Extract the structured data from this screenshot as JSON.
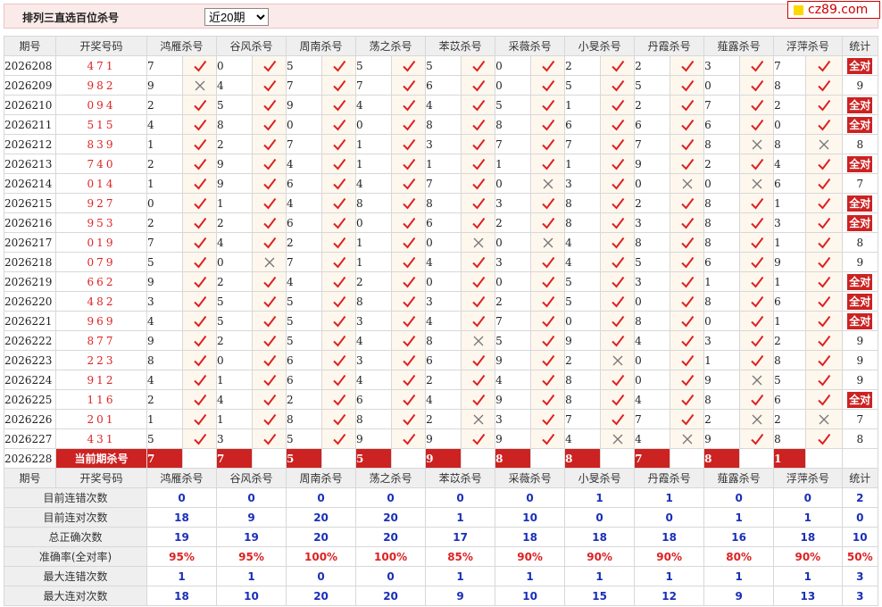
{
  "title": "排列三直选百位杀号",
  "period_select": {
    "value": "近20期",
    "options": [
      "近20期"
    ]
  },
  "logo": "cz89.com",
  "colors": {
    "hit": "#d22",
    "miss": "#777",
    "accent": "#cc2222",
    "stat": "#1a2fb8"
  },
  "headers": [
    "期号",
    "开奖号码",
    "鸿雁杀号",
    "谷风杀号",
    "周南杀号",
    "荡之杀号",
    "苯苡杀号",
    "采薇杀号",
    "小旻杀号",
    "丹霞杀号",
    "薤露杀号",
    "浮萍杀号",
    "统计"
  ],
  "rows": [
    {
      "period": "2026208",
      "drawn": "471",
      "kills": [
        "7",
        "0",
        "5",
        "5",
        "5",
        "0",
        "2",
        "2",
        "3",
        "7"
      ],
      "hits": [
        1,
        1,
        1,
        1,
        1,
        1,
        1,
        1,
        1,
        1
      ],
      "total": "全对"
    },
    {
      "period": "2026209",
      "drawn": "982",
      "kills": [
        "9",
        "4",
        "7",
        "7",
        "6",
        "0",
        "5",
        "5",
        "0",
        "8"
      ],
      "hits": [
        0,
        1,
        1,
        1,
        1,
        1,
        1,
        1,
        1,
        1
      ],
      "total": "9"
    },
    {
      "period": "2026210",
      "drawn": "094",
      "kills": [
        "2",
        "5",
        "9",
        "4",
        "4",
        "5",
        "1",
        "2",
        "7",
        "2"
      ],
      "hits": [
        1,
        1,
        1,
        1,
        1,
        1,
        1,
        1,
        1,
        1
      ],
      "total": "全对"
    },
    {
      "period": "2026211",
      "drawn": "515",
      "kills": [
        "4",
        "8",
        "0",
        "0",
        "8",
        "8",
        "6",
        "6",
        "6",
        "0"
      ],
      "hits": [
        1,
        1,
        1,
        1,
        1,
        1,
        1,
        1,
        1,
        1
      ],
      "total": "全对"
    },
    {
      "period": "2026212",
      "drawn": "839",
      "kills": [
        "1",
        "2",
        "7",
        "1",
        "3",
        "7",
        "7",
        "7",
        "8",
        "8"
      ],
      "hits": [
        1,
        1,
        1,
        1,
        1,
        1,
        1,
        1,
        0,
        0
      ],
      "total": "8"
    },
    {
      "period": "2026213",
      "drawn": "740",
      "kills": [
        "2",
        "9",
        "4",
        "1",
        "1",
        "1",
        "1",
        "9",
        "2",
        "4"
      ],
      "hits": [
        1,
        1,
        1,
        1,
        1,
        1,
        1,
        1,
        1,
        1
      ],
      "total": "全对"
    },
    {
      "period": "2026214",
      "drawn": "014",
      "kills": [
        "1",
        "9",
        "6",
        "4",
        "7",
        "0",
        "3",
        "0",
        "0",
        "6"
      ],
      "hits": [
        1,
        1,
        1,
        1,
        1,
        0,
        1,
        0,
        0,
        1
      ],
      "total": "7"
    },
    {
      "period": "2026215",
      "drawn": "927",
      "kills": [
        "0",
        "1",
        "4",
        "8",
        "8",
        "3",
        "8",
        "2",
        "8",
        "1"
      ],
      "hits": [
        1,
        1,
        1,
        1,
        1,
        1,
        1,
        1,
        1,
        1
      ],
      "total": "全对"
    },
    {
      "period": "2026216",
      "drawn": "953",
      "kills": [
        "2",
        "2",
        "6",
        "0",
        "6",
        "2",
        "8",
        "3",
        "8",
        "3"
      ],
      "hits": [
        1,
        1,
        1,
        1,
        1,
        1,
        1,
        1,
        1,
        1
      ],
      "total": "全对"
    },
    {
      "period": "2026217",
      "drawn": "019",
      "kills": [
        "7",
        "4",
        "2",
        "1",
        "0",
        "0",
        "4",
        "8",
        "8",
        "1"
      ],
      "hits": [
        1,
        1,
        1,
        1,
        0,
        0,
        1,
        1,
        1,
        1
      ],
      "total": "8"
    },
    {
      "period": "2026218",
      "drawn": "079",
      "kills": [
        "5",
        "0",
        "7",
        "1",
        "4",
        "3",
        "4",
        "5",
        "6",
        "9"
      ],
      "hits": [
        1,
        0,
        1,
        1,
        1,
        1,
        1,
        1,
        1,
        1
      ],
      "total": "9"
    },
    {
      "period": "2026219",
      "drawn": "662",
      "kills": [
        "9",
        "2",
        "4",
        "2",
        "0",
        "0",
        "5",
        "3",
        "1",
        "1"
      ],
      "hits": [
        1,
        1,
        1,
        1,
        1,
        1,
        1,
        1,
        1,
        1
      ],
      "total": "全对"
    },
    {
      "period": "2026220",
      "drawn": "482",
      "kills": [
        "3",
        "5",
        "5",
        "8",
        "3",
        "2",
        "5",
        "0",
        "8",
        "6"
      ],
      "hits": [
        1,
        1,
        1,
        1,
        1,
        1,
        1,
        1,
        1,
        1
      ],
      "total": "全对"
    },
    {
      "period": "2026221",
      "drawn": "969",
      "kills": [
        "4",
        "5",
        "5",
        "3",
        "4",
        "7",
        "0",
        "8",
        "0",
        "1"
      ],
      "hits": [
        1,
        1,
        1,
        1,
        1,
        1,
        1,
        1,
        1,
        1
      ],
      "total": "全对"
    },
    {
      "period": "2026222",
      "drawn": "877",
      "kills": [
        "9",
        "2",
        "5",
        "4",
        "8",
        "5",
        "9",
        "4",
        "3",
        "2"
      ],
      "hits": [
        1,
        1,
        1,
        1,
        0,
        1,
        1,
        1,
        1,
        1
      ],
      "total": "9"
    },
    {
      "period": "2026223",
      "drawn": "223",
      "kills": [
        "8",
        "0",
        "6",
        "3",
        "6",
        "9",
        "2",
        "0",
        "1",
        "8"
      ],
      "hits": [
        1,
        1,
        1,
        1,
        1,
        1,
        0,
        1,
        1,
        1
      ],
      "total": "9"
    },
    {
      "period": "2026224",
      "drawn": "912",
      "kills": [
        "4",
        "1",
        "6",
        "4",
        "2",
        "4",
        "8",
        "0",
        "9",
        "5"
      ],
      "hits": [
        1,
        1,
        1,
        1,
        1,
        1,
        1,
        1,
        0,
        1
      ],
      "total": "9"
    },
    {
      "period": "2026225",
      "drawn": "116",
      "kills": [
        "2",
        "4",
        "2",
        "6",
        "4",
        "9",
        "8",
        "4",
        "8",
        "6"
      ],
      "hits": [
        1,
        1,
        1,
        1,
        1,
        1,
        1,
        1,
        1,
        1
      ],
      "total": "全对"
    },
    {
      "period": "2026226",
      "drawn": "201",
      "kills": [
        "1",
        "1",
        "8",
        "8",
        "2",
        "3",
        "7",
        "7",
        "2",
        "2"
      ],
      "hits": [
        1,
        1,
        1,
        1,
        0,
        1,
        1,
        1,
        0,
        0
      ],
      "total": "7"
    },
    {
      "period": "2026227",
      "drawn": "431",
      "kills": [
        "5",
        "3",
        "5",
        "9",
        "9",
        "9",
        "4",
        "4",
        "9",
        "8"
      ],
      "hits": [
        1,
        1,
        1,
        1,
        1,
        1,
        0,
        0,
        1,
        1
      ],
      "total": "8"
    }
  ],
  "current": {
    "period": "2026228",
    "label": "当前期杀号",
    "kills": [
      "7",
      "7",
      "5",
      "5",
      "9",
      "8",
      "8",
      "7",
      "8",
      "1"
    ]
  },
  "stats_header": [
    "期号",
    "开奖号码",
    "鸿雁杀号",
    "谷风杀号",
    "周南杀号",
    "荡之杀号",
    "苯苡杀号",
    "采薇杀号",
    "小旻杀号",
    "丹霞杀号",
    "薤露杀号",
    "浮萍杀号",
    "统计"
  ],
  "stats": [
    {
      "label": "目前连错次数",
      "values": [
        "0",
        "0",
        "0",
        "0",
        "0",
        "0",
        "1",
        "1",
        "0",
        "0",
        "2"
      ],
      "red": false
    },
    {
      "label": "目前连对次数",
      "values": [
        "18",
        "9",
        "20",
        "20",
        "1",
        "10",
        "0",
        "0",
        "1",
        "1",
        "0"
      ],
      "red": false
    },
    {
      "label": "总正确次数",
      "values": [
        "19",
        "19",
        "20",
        "20",
        "17",
        "18",
        "18",
        "18",
        "16",
        "18",
        "10"
      ],
      "red": false
    },
    {
      "label": "准确率(全对率)",
      "values": [
        "95%",
        "95%",
        "100%",
        "100%",
        "85%",
        "90%",
        "90%",
        "90%",
        "80%",
        "90%",
        "50%"
      ],
      "red": true
    },
    {
      "label": "最大连错次数",
      "values": [
        "1",
        "1",
        "0",
        "0",
        "1",
        "1",
        "1",
        "1",
        "1",
        "1",
        "3"
      ],
      "red": false
    },
    {
      "label": "最大连对次数",
      "values": [
        "18",
        "10",
        "20",
        "20",
        "9",
        "10",
        "15",
        "12",
        "9",
        "13",
        "3"
      ],
      "red": false
    }
  ]
}
